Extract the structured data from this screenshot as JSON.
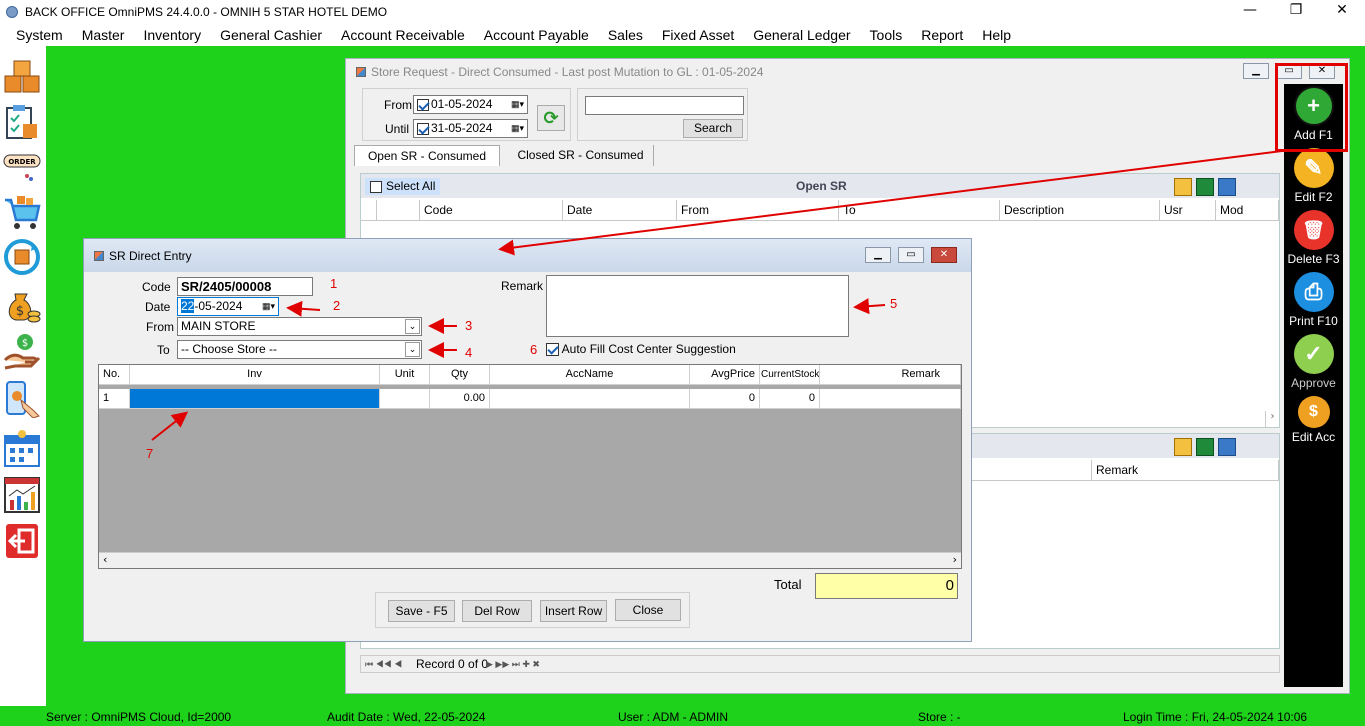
{
  "app": {
    "title": "BACK OFFICE OmniPMS 24.4.0.0 - OMNIH 5 STAR HOTEL DEMO",
    "controls": {
      "minimize": "—",
      "restore": "❐",
      "close": "✕"
    }
  },
  "menu": [
    "System",
    "Master",
    "Inventory",
    "General Cashier",
    "Account Receivable",
    "Account Payable",
    "Sales",
    "Fixed Asset",
    "General Ledger",
    "Tools",
    "Report",
    "Help"
  ],
  "sidebar_icons": [
    "boxes-icon",
    "clipboard-box-icon",
    "order-icon",
    "cart-icon",
    "sync-icon",
    "money-bag-icon",
    "hand-money-icon",
    "phone-tap-icon",
    "calendar-icon",
    "chart-icon",
    "exit-icon"
  ],
  "sidebar_order_text": "ORDER",
  "store_window": {
    "title": "Store Request - Direct Consumed - Last post Mutation to GL : 01-05-2024",
    "from_label": "From",
    "until_label": "Until",
    "from_date": "01-05-2024",
    "until_date": "31-05-2024",
    "search_value": "",
    "search_button": "Search",
    "tabs": [
      "Open SR - Consumed",
      "Closed SR - Consumed"
    ],
    "select_all": "Select All",
    "grid_title": "Open SR",
    "columns": [
      "Code",
      "Date",
      "From",
      "To",
      "Description",
      "Usr",
      "Mod"
    ],
    "detail_column": "Remark",
    "record_text": "Record 0 of 0"
  },
  "right_toolbar": [
    {
      "label": "Add F1",
      "icon": "plus-icon",
      "color": "#2fa836",
      "glyph": "+"
    },
    {
      "label": "Edit F2",
      "icon": "edit-icon",
      "color": "#f3b323",
      "glyph": "✎"
    },
    {
      "label": "Delete F3",
      "icon": "trash-icon",
      "color": "#e8332b",
      "glyph": "🗑"
    },
    {
      "label": "Print F10",
      "icon": "printer-icon",
      "color": "#1c8fe0",
      "glyph": "⎙"
    },
    {
      "label": "Approve",
      "icon": "check-icon",
      "color": "#8fcf4f",
      "glyph": "✓"
    },
    {
      "label": "Edit Acc",
      "icon": "coin-edit-icon",
      "color": "#f0a020",
      "glyph": "$"
    }
  ],
  "dialog": {
    "title": "SR Direct Entry",
    "code_label": "Code",
    "code_value": "SR/2405/00008",
    "date_label": "Date",
    "date_value_sel": "22",
    "date_value_rest": "-05-2024",
    "from_label": "From",
    "from_value": "MAIN STORE",
    "to_label": "To",
    "to_value": "-- Choose Store --",
    "remark_label": "Remark",
    "remark_value": "",
    "autofill_label": "Auto Fill Cost Center Suggestion",
    "grid_columns": [
      "No.",
      "Inv",
      "Unit",
      "Qty",
      "AccName",
      "AvgPrice",
      "CurrentStock",
      "Remark"
    ],
    "grid_rows": [
      {
        "no": "1",
        "inv": "",
        "unit": "",
        "qty": "0.00",
        "accname": "",
        "avgprice": "0",
        "stock": "0",
        "remark": ""
      }
    ],
    "total_label": "Total",
    "total_value": "0",
    "buttons": {
      "save": "Save - F5",
      "delrow": "Del Row",
      "insertrow": "Insert Row",
      "close": "Close"
    }
  },
  "annotations": [
    "1",
    "2",
    "3",
    "4",
    "5",
    "6",
    "7"
  ],
  "status": {
    "server": "Server : OmniPMS Cloud, Id=2000",
    "audit": "Audit Date : Wed, 22-05-2024",
    "user": "User : ADM - ADMIN",
    "store": "Store :  -",
    "login": "Login Time : Fri, 24-05-2024 10:06"
  },
  "colors": {
    "desktop": "#1ed11a",
    "highlight": "#e00000",
    "selection": "#0078d7",
    "total_bg": "#ffffa8"
  }
}
